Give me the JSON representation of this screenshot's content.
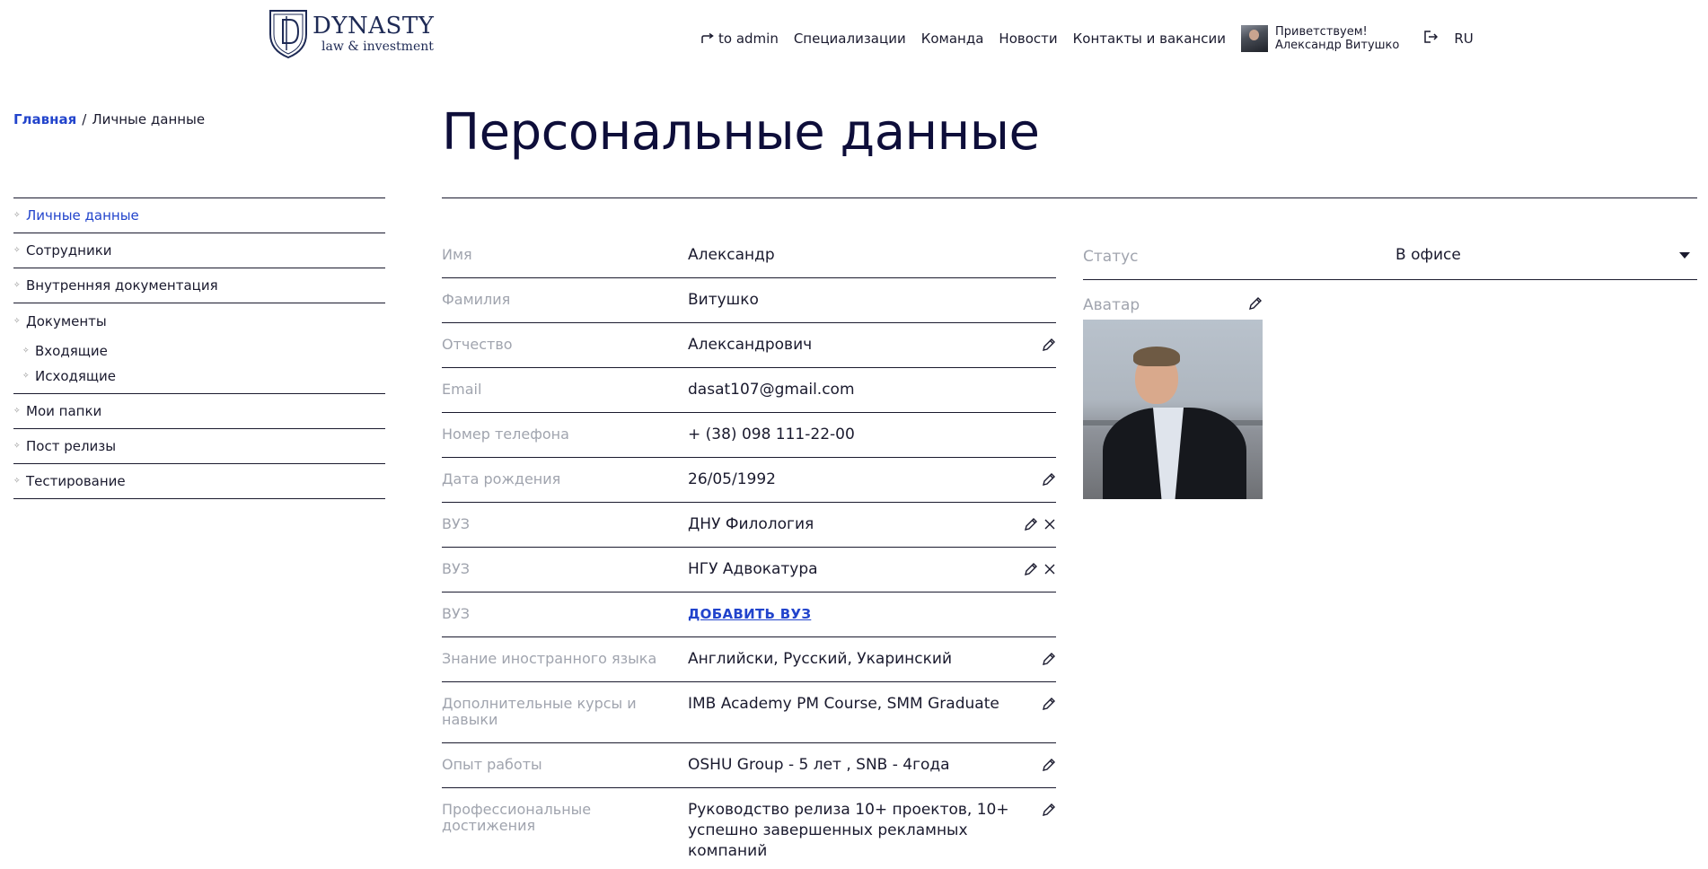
{
  "header": {
    "logo": {
      "title": "DYNASTY",
      "subtitle": "law & investment"
    },
    "nav": {
      "to_admin": "to admin",
      "items": [
        "Специализации",
        "Команда",
        "Новости",
        "Контакты и вакансии"
      ]
    },
    "user": {
      "greeting": "Приветствуем!",
      "name": "Александр Витушко"
    },
    "lang": "RU"
  },
  "breadcrumb": {
    "home": "Главная",
    "separator": "/",
    "current": "Личные данные"
  },
  "sidebar": {
    "items": [
      {
        "label": "Личные данные",
        "active": true
      },
      {
        "label": "Сотрудники"
      },
      {
        "label": "Внутренняя документация"
      },
      {
        "label": "Документы",
        "children": [
          "Входящие",
          "Исходящие"
        ]
      },
      {
        "label": "Мои папки"
      },
      {
        "label": "Пост релизы"
      },
      {
        "label": "Тестирование"
      }
    ]
  },
  "page": {
    "title": "Персональные данные"
  },
  "form": {
    "fields": [
      {
        "label": "Имя",
        "value": "Александр"
      },
      {
        "label": "Фамилия",
        "value": "Витушко"
      },
      {
        "label": "Отчество",
        "value": "Александрович"
      },
      {
        "label": "Email",
        "value": "dasat107@gmail.com"
      },
      {
        "label": "Номер телефона",
        "value": "+ (38) 098 111-22-00"
      },
      {
        "label": "Дата рождения",
        "value": "26/05/1992"
      },
      {
        "label": "ВУЗ",
        "value": "ДНУ Филология"
      },
      {
        "label": "ВУЗ",
        "value": "НГУ Адвокатура"
      },
      {
        "label": "ВУЗ",
        "value": "ДОБАВИТЬ ВУЗ"
      },
      {
        "label": "Знание иностранного языка",
        "value": "Английски, Русский, Укаринский"
      },
      {
        "label": "Дополнительные курсы и навыки",
        "value": "IMB Academy PM Course, SMM Graduate"
      },
      {
        "label": "Опыт работы",
        "value": "OSHU Group - 5 лет , SNB - 4года"
      },
      {
        "label": "Профессиональные достижения",
        "value": "Руководство релиза 10+ проектов, 10+ успешно завершенных рекламных компаний"
      }
    ]
  },
  "status": {
    "label": "Статус",
    "value": "В офисе"
  },
  "avatar": {
    "label": "Аватар"
  },
  "colors": {
    "accent": "#2244cc",
    "text": "#1a1a2e",
    "muted_label": "#a0a4ae",
    "title": "#0e0e3a"
  }
}
